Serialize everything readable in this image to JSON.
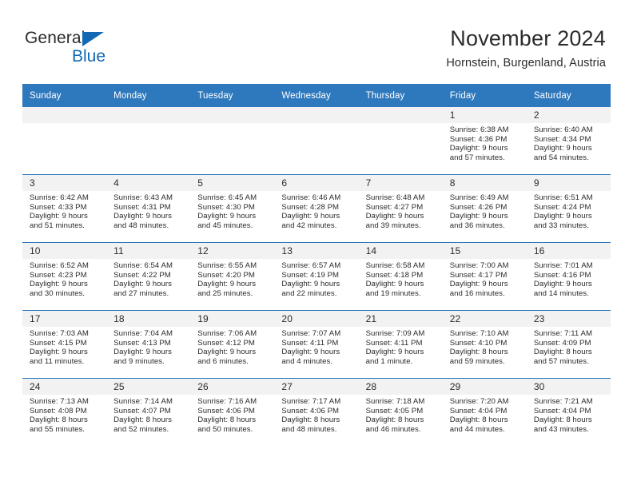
{
  "brand": {
    "word_one": "General",
    "word_two": "Blue",
    "accent_color": "#1268b3",
    "flag_icon": "triangle-flag-icon"
  },
  "header": {
    "title": "November 2024",
    "location": "Hornstein, Burgenland, Austria"
  },
  "calendar": {
    "header_bg": "#2e78bd",
    "daynum_bg": "#f2f2f2",
    "weekday_headers": [
      "Sunday",
      "Monday",
      "Tuesday",
      "Wednesday",
      "Thursday",
      "Friday",
      "Saturday"
    ],
    "weeks": [
      [
        {
          "day": "",
          "empty": true
        },
        {
          "day": "",
          "empty": true
        },
        {
          "day": "",
          "empty": true
        },
        {
          "day": "",
          "empty": true
        },
        {
          "day": "",
          "empty": true
        },
        {
          "day": "1",
          "sunrise": "Sunrise: 6:38 AM",
          "sunset": "Sunset: 4:36 PM",
          "daylight": "Daylight: 9 hours and 57 minutes."
        },
        {
          "day": "2",
          "sunrise": "Sunrise: 6:40 AM",
          "sunset": "Sunset: 4:34 PM",
          "daylight": "Daylight: 9 hours and 54 minutes."
        }
      ],
      [
        {
          "day": "3",
          "sunrise": "Sunrise: 6:42 AM",
          "sunset": "Sunset: 4:33 PM",
          "daylight": "Daylight: 9 hours and 51 minutes."
        },
        {
          "day": "4",
          "sunrise": "Sunrise: 6:43 AM",
          "sunset": "Sunset: 4:31 PM",
          "daylight": "Daylight: 9 hours and 48 minutes."
        },
        {
          "day": "5",
          "sunrise": "Sunrise: 6:45 AM",
          "sunset": "Sunset: 4:30 PM",
          "daylight": "Daylight: 9 hours and 45 minutes."
        },
        {
          "day": "6",
          "sunrise": "Sunrise: 6:46 AM",
          "sunset": "Sunset: 4:28 PM",
          "daylight": "Daylight: 9 hours and 42 minutes."
        },
        {
          "day": "7",
          "sunrise": "Sunrise: 6:48 AM",
          "sunset": "Sunset: 4:27 PM",
          "daylight": "Daylight: 9 hours and 39 minutes."
        },
        {
          "day": "8",
          "sunrise": "Sunrise: 6:49 AM",
          "sunset": "Sunset: 4:26 PM",
          "daylight": "Daylight: 9 hours and 36 minutes."
        },
        {
          "day": "9",
          "sunrise": "Sunrise: 6:51 AM",
          "sunset": "Sunset: 4:24 PM",
          "daylight": "Daylight: 9 hours and 33 minutes."
        }
      ],
      [
        {
          "day": "10",
          "sunrise": "Sunrise: 6:52 AM",
          "sunset": "Sunset: 4:23 PM",
          "daylight": "Daylight: 9 hours and 30 minutes."
        },
        {
          "day": "11",
          "sunrise": "Sunrise: 6:54 AM",
          "sunset": "Sunset: 4:22 PM",
          "daylight": "Daylight: 9 hours and 27 minutes."
        },
        {
          "day": "12",
          "sunrise": "Sunrise: 6:55 AM",
          "sunset": "Sunset: 4:20 PM",
          "daylight": "Daylight: 9 hours and 25 minutes."
        },
        {
          "day": "13",
          "sunrise": "Sunrise: 6:57 AM",
          "sunset": "Sunset: 4:19 PM",
          "daylight": "Daylight: 9 hours and 22 minutes."
        },
        {
          "day": "14",
          "sunrise": "Sunrise: 6:58 AM",
          "sunset": "Sunset: 4:18 PM",
          "daylight": "Daylight: 9 hours and 19 minutes."
        },
        {
          "day": "15",
          "sunrise": "Sunrise: 7:00 AM",
          "sunset": "Sunset: 4:17 PM",
          "daylight": "Daylight: 9 hours and 16 minutes."
        },
        {
          "day": "16",
          "sunrise": "Sunrise: 7:01 AM",
          "sunset": "Sunset: 4:16 PM",
          "daylight": "Daylight: 9 hours and 14 minutes."
        }
      ],
      [
        {
          "day": "17",
          "sunrise": "Sunrise: 7:03 AM",
          "sunset": "Sunset: 4:15 PM",
          "daylight": "Daylight: 9 hours and 11 minutes."
        },
        {
          "day": "18",
          "sunrise": "Sunrise: 7:04 AM",
          "sunset": "Sunset: 4:13 PM",
          "daylight": "Daylight: 9 hours and 9 minutes."
        },
        {
          "day": "19",
          "sunrise": "Sunrise: 7:06 AM",
          "sunset": "Sunset: 4:12 PM",
          "daylight": "Daylight: 9 hours and 6 minutes."
        },
        {
          "day": "20",
          "sunrise": "Sunrise: 7:07 AM",
          "sunset": "Sunset: 4:11 PM",
          "daylight": "Daylight: 9 hours and 4 minutes."
        },
        {
          "day": "21",
          "sunrise": "Sunrise: 7:09 AM",
          "sunset": "Sunset: 4:11 PM",
          "daylight": "Daylight: 9 hours and 1 minute."
        },
        {
          "day": "22",
          "sunrise": "Sunrise: 7:10 AM",
          "sunset": "Sunset: 4:10 PM",
          "daylight": "Daylight: 8 hours and 59 minutes."
        },
        {
          "day": "23",
          "sunrise": "Sunrise: 7:11 AM",
          "sunset": "Sunset: 4:09 PM",
          "daylight": "Daylight: 8 hours and 57 minutes."
        }
      ],
      [
        {
          "day": "24",
          "sunrise": "Sunrise: 7:13 AM",
          "sunset": "Sunset: 4:08 PM",
          "daylight": "Daylight: 8 hours and 55 minutes."
        },
        {
          "day": "25",
          "sunrise": "Sunrise: 7:14 AM",
          "sunset": "Sunset: 4:07 PM",
          "daylight": "Daylight: 8 hours and 52 minutes."
        },
        {
          "day": "26",
          "sunrise": "Sunrise: 7:16 AM",
          "sunset": "Sunset: 4:06 PM",
          "daylight": "Daylight: 8 hours and 50 minutes."
        },
        {
          "day": "27",
          "sunrise": "Sunrise: 7:17 AM",
          "sunset": "Sunset: 4:06 PM",
          "daylight": "Daylight: 8 hours and 48 minutes."
        },
        {
          "day": "28",
          "sunrise": "Sunrise: 7:18 AM",
          "sunset": "Sunset: 4:05 PM",
          "daylight": "Daylight: 8 hours and 46 minutes."
        },
        {
          "day": "29",
          "sunrise": "Sunrise: 7:20 AM",
          "sunset": "Sunset: 4:04 PM",
          "daylight": "Daylight: 8 hours and 44 minutes."
        },
        {
          "day": "30",
          "sunrise": "Sunrise: 7:21 AM",
          "sunset": "Sunset: 4:04 PM",
          "daylight": "Daylight: 8 hours and 43 minutes."
        }
      ]
    ]
  }
}
